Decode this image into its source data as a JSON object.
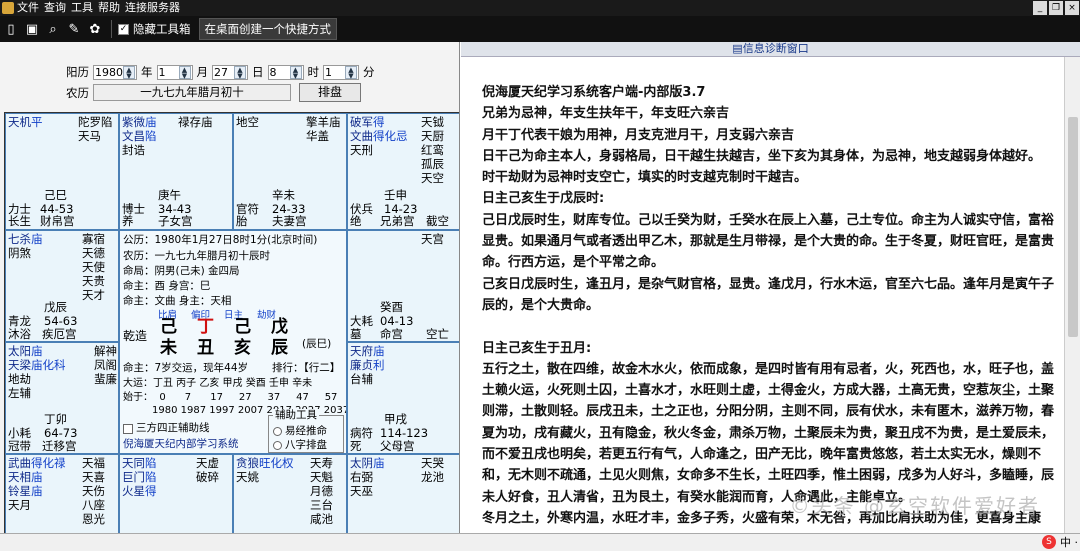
{
  "menu": {
    "items": [
      "文件",
      "查询",
      "工具",
      "帮助",
      "连接服务器"
    ]
  },
  "toolbar": {
    "hide_label": "隐藏工具箱",
    "shortcut_label": "在桌面创建一个快捷方式"
  },
  "form": {
    "solar_label": "阳历",
    "year": "1980",
    "year_unit": "年",
    "month": "1",
    "month_unit": "月",
    "day": "27",
    "day_unit": "日",
    "hour": "8",
    "hour_unit": "时",
    "minute": "1",
    "minute_unit": "分",
    "lunar_label": "农历",
    "lunar_value": "一九七九年腊月初十",
    "submit": "排盘"
  },
  "palaces": [
    {
      "text": "天机平\n\n\n\n力士\n长生"
    },
    {
      "text": "紫微庙\n文昌陷\n封诰\n\n博士\n养"
    },
    {
      "text": "地空\n\n\n\n官符\n胎"
    },
    {
      "text": "破军得\n文曲得化忌\n天刑\n\n伏兵\n绝"
    }
  ],
  "p_sw": {
    "stars": "天机",
    "stars_level": "平",
    "s2": "陀罗陷\n天马",
    "gz": "己巳",
    "age": "44-53",
    "god": "力士",
    "life": "长生",
    "name": "财帛宫"
  },
  "p_s": {
    "s1": "紫微",
    "s1_level": "庙",
    "s2": "文昌",
    "s2_level": "陷",
    "s3": "封诰",
    "s4": "禄存庙",
    "gz": "庚午",
    "age": "34-43",
    "god": "博士",
    "life": "养",
    "name": "子女宫"
  },
  "p_ss": {
    "s1": "地空",
    "s2": "擎羊庙\n华盖",
    "gz": "辛未",
    "age": "24-33",
    "god": "官符",
    "life": "胎",
    "name": "夫妻宫"
  },
  "p_se": {
    "s1": "破军",
    "s1_level": "得",
    "s2": "文曲",
    "s2_level": "得化忌",
    "s3": "天刑",
    "right": "天钺\n天厨\n红鸾\n孤辰\n天空",
    "gz": "壬申",
    "age": "14-23",
    "god": "伏兵",
    "life": "绝",
    "name": "兄弟宫",
    "extra": "截空"
  },
  "p_w": {
    "s1": "七杀",
    "s1_level": "庙",
    "s2": "阴煞",
    "right": "寡宿\n天德\n天使\n天贵\n天才",
    "gz": "戊辰",
    "age": "54-63",
    "god": "青龙",
    "life": "沐浴",
    "name": "疾厄宫"
  },
  "p_e": {
    "s1": "天宫",
    "gz": "癸酉",
    "age": "04-13",
    "god": "大耗",
    "life": "墓",
    "name": "命宫",
    "extra": "空亡"
  },
  "p_nw": {
    "s1": "太阳",
    "s1_level": "庙",
    "s2": "天梁",
    "s2_level": "庙化科",
    "s3": "地劫",
    "s4": "左辅",
    "right": "解神\n凤阁\n蜚廉",
    "gz": "丁卯",
    "age": "64-73",
    "god": "小耗",
    "life": "冠带",
    "name": "迁移宫"
  },
  "p_ne": {
    "s1": "天府",
    "s1_level": "庙",
    "s2": "廉贞",
    "s2_level": "利",
    "s3": "台辅",
    "gz": "甲戌",
    "age": "114-123",
    "god": "病符",
    "life": "死",
    "name": "父母宫"
  },
  "p_b1": {
    "s1": "武曲",
    "s1_level": "得化禄",
    "s2": "天相",
    "s2_level": "庙",
    "s3": "铃星",
    "s3_level": "庙",
    "s4": "天月",
    "right": "天福\n天喜\n天伤\n八座\n恩光"
  },
  "p_b2": {
    "s1": "天同",
    "s1_level": "陷",
    "s2": "巨门",
    "s2_level": "陷",
    "s3": "火星",
    "s3_level": "得",
    "right": "天虚\n破碎"
  },
  "p_b3": {
    "s1": "贪狼",
    "s1_level": "旺化权",
    "s2": "天姚",
    "right": "天寿\n天魁\n月德\n三台\n咸池"
  },
  "p_b4": {
    "s1": "太阴",
    "s1_level": "庙",
    "s2": "右弼",
    "s3": "天巫",
    "right": "天哭\n龙池"
  },
  "center": {
    "gongli": "公历：1980年1月27日8时1分(北京时间)",
    "nongli": "农历：一九七九年腊月初十辰时",
    "mingju": "命局：阴男(己未)    金四局",
    "mingzhu": "命主：酉  身宫：巳",
    "shenzhu": "命主：文曲  身主：天相",
    "shishen": [
      "比肩",
      "偏印",
      "日主",
      "劫财"
    ],
    "qianzao": "乾造",
    "stems": [
      "己",
      "丁",
      "己",
      "戊"
    ],
    "branches": [
      "未",
      "丑",
      "亥",
      "辰"
    ],
    "chen": "(辰巳)",
    "mingzhu2": "命主：7岁交运，现年44岁",
    "paihang": "排行：【行二】",
    "dayun": "大运：丁丑 丙子 乙亥 甲戌 癸酉 壬申 辛未",
    "shisui": "始于：  0      7      17     27     37     47     57",
    "years": "1980 1987 1997 2007 2017 2027 2037",
    "sanfang": "三方四正辅助线",
    "tools": "辅助工具",
    "opt1": "易经推命",
    "opt2": "八字排盘",
    "ad": "倪海厦天纪内部学习系统"
  },
  "diag": {
    "title": "信息诊断窗口"
  },
  "article": [
    {
      "t": "倪海厦天纪学习系统客户端-内部版3.7",
      "b": true
    },
    {
      "t": "兄弟为忌神，年支生扶年干，年支旺六亲吉",
      "b": true
    },
    {
      "t": "月干丁代表干娘为用神，月支克泄月干，月支弱六亲吉",
      "b": true
    },
    {
      "t": "日干己为命主本人，身弱格局，日干越生扶越吉，坐下亥为其身体，为忌神，地支越弱身体越好。",
      "b": true
    },
    {
      "t": "时干劫财为忌神时支空亡，填实的时支越克制时干越吉。",
      "b": true
    },
    {
      "t": "日主己亥生于戊辰时:",
      "b": true
    },
    {
      "t": "  己日戊辰时生，财库专位。己以壬癸为财，壬癸水在辰上入墓，己土专位。命主为人诚实守信，富裕显贵。如果通月气或者透出甲乙木，那就是生月带禄，是个大贵的命。生于冬夏，财旺官旺，是富贵命。行西方运，是个平常之命。",
      "b": true
    },
    {
      "t": "  己亥日戊辰时生，逢丑月，是杂气财官格，显贵。逢戊月，行水木运，官至六七品。逢年月是寅午子辰的，是个大贵命。",
      "b": true
    },
    {
      "t": "",
      "b": false
    },
    {
      "t": "日主己亥生于丑月:",
      "b": true
    },
    {
      "t": "  五行之土，散在四维，故金木水火，依而成象，是四时皆有用有忌者，火，死西也，水，旺子也，盖土赖火运，火死则土囚，土喜水才，水旺则土虚，土得金火，方成大器，土高无贵，空惹灰尘，土聚则滞，土散则轻。辰戌丑未，土之正也，分阳分阴，主则不同，辰有伏水，未有匿木，滋养万物，春夏为功，戌有藏火，丑有隐金，秋火冬金，肃杀万物，土聚辰未为贵，聚丑戌不为贵，是土爱辰未，而不爱丑戌也明矣，若更五行有气，人命逢之，田产无比，晚年富贵悠悠，若土太实无水，燥则不和，无木则不疏通，土见火则焦，女命多不生长，土旺四季，惟土困弱，戌多为人好斗，多瞌睡，辰未人好食，丑人清省，丑为艮土，有癸水能润而育，人命遇此，主能卓立。",
      "b": true
    },
    {
      "t": "  冬月之土，外寒内温，水旺才丰，金多子秀，火盛有荣，木无咎，再加比肩扶助为佳，更喜身主康",
      "b": true
    }
  ],
  "watermark": "©头条 @玄空软件爱好者",
  "ime": "中 ·"
}
